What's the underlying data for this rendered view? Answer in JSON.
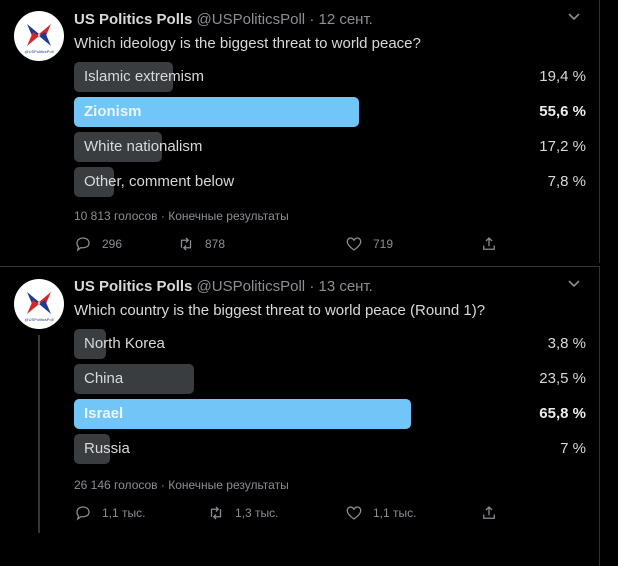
{
  "tweets": [
    {
      "author": {
        "name": "US Politics Polls",
        "handle": "@USPoliticsPoll",
        "avatar": "usp-logo"
      },
      "separator": "·",
      "date": "12 сент.",
      "question": "Which ideology is the biggest threat to world peace?",
      "options": [
        {
          "label": "Islamic extremism",
          "percent": "19,4 %",
          "value": 19.4,
          "winner": false
        },
        {
          "label": "Zionism",
          "percent": "55,6 %",
          "value": 55.6,
          "winner": true
        },
        {
          "label": "White nationalism",
          "percent": "17,2 %",
          "value": 17.2,
          "winner": false
        },
        {
          "label": "Other, comment below",
          "percent": "7,8 %",
          "value": 7.8,
          "winner": false
        }
      ],
      "votes": "10 813 голосов · Конечные результаты",
      "actions": {
        "replies": "296",
        "retweets": "878",
        "likes": "719"
      }
    },
    {
      "author": {
        "name": "US Politics Polls",
        "handle": "@USPoliticsPoll",
        "avatar": "usp-logo"
      },
      "separator": "·",
      "date": "13 сент.",
      "question": "Which country is the biggest threat to world peace (Round 1)?",
      "options": [
        {
          "label": "North Korea",
          "percent": "3,8 %",
          "value": 3.8,
          "winner": false
        },
        {
          "label": "China",
          "percent": "23,5 %",
          "value": 23.5,
          "winner": false
        },
        {
          "label": "Israel",
          "percent": "65,8 %",
          "value": 65.8,
          "winner": true
        },
        {
          "label": "Russia",
          "percent": "7 %",
          "value": 7,
          "winner": false
        }
      ],
      "votes": "26 146 голосов · Конечные результаты",
      "actions": {
        "replies": "1,1 тыс.",
        "retweets": "1,3 тыс.",
        "likes": "1,1 тыс."
      }
    }
  ],
  "colors": {
    "background": "#000000",
    "winner_bar": "#72c6f7",
    "bar": "#3a3d40",
    "muted": "#8a8f94"
  },
  "icons": [
    "reply-icon",
    "retweet-icon",
    "like-icon",
    "share-icon",
    "chevron-down-icon"
  ]
}
